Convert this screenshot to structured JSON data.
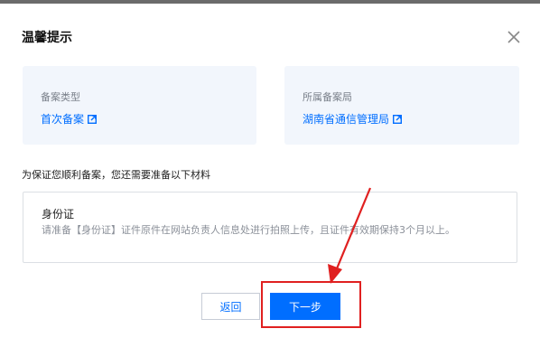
{
  "dialog": {
    "title": "温馨提示",
    "close_icon": "close-icon"
  },
  "cards": [
    {
      "label": "备案类型",
      "value": "首次备案",
      "icon": "external-link-icon"
    },
    {
      "label": "所属备案局",
      "value": "湖南省通信管理局",
      "icon": "external-link-icon"
    }
  ],
  "note": "为保证您顺利备案，您还需要准备以下材料",
  "id_card": {
    "title": "身份证",
    "description": "请准备【身份证】证件原件在网站负责人信息处进行拍照上传，且证件有效期保持3个月以上。"
  },
  "buttons": {
    "back": "返回",
    "next": "下一步"
  },
  "annotation": {
    "color": "#e02020"
  },
  "colors": {
    "primary": "#006eff",
    "card_bg": "#f2f6fc"
  }
}
